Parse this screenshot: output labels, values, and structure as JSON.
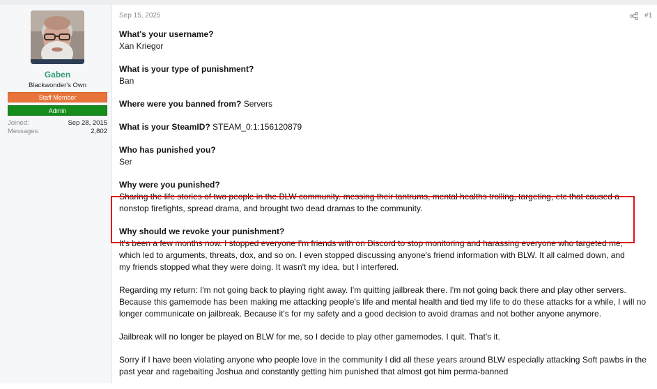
{
  "user": {
    "name": "Gaben",
    "title": "Blackwonder's Own",
    "banners": [
      "Staff Member",
      "Admin"
    ],
    "banner_colors": {
      "staff": "#e8743b",
      "admin": "#158c1c"
    },
    "name_color": "#2e9c6f",
    "joined_label": "Joined:",
    "joined_value": "Sep 28, 2015",
    "messages_label": "Messages:",
    "messages_value": "2,802"
  },
  "post": {
    "date": "Sep 15, 2025",
    "number": "#1",
    "share_icon": "share-icon",
    "highlight_color": "#dd0f17",
    "q_username": "What's your username?",
    "a_username": "Xan Kriegor",
    "q_type": "What is your type of punishment?",
    "a_type": "Ban",
    "q_where": "Where were you banned from?",
    "a_where": " Servers",
    "q_steamid": "What is your SteamID?",
    "a_steamid": " STEAM_0:1:156120879",
    "q_who": "Who has punished you?",
    "a_who": "Ser",
    "q_why": "Why were you punished?",
    "a_why": "Sharing the life stories of two people in the BLW community. messing their tantrums, mental healths trolling, targeting, etc that caused a nonstop firefights, spread drama, and brought two dead dramas to the community.",
    "q_revoke": "Why should we revoke your punishment?",
    "p1": "It's been a few months now. I stopped everyone I'm friends with on Discord to stop monitoring and harassing everyone who targeted me, which led to arguments, threats, dox, and so on. I even stopped discussing anyone's friend information with BLW. It all calmed down, and my friends stopped what they were doing. It wasn't my idea, but I interfered.",
    "p2": "Regarding my return: I'm not going back to playing right away. I'm quitting jailbreak there. I'm not going back there and play other servers. Because this gamemode has been making me attacking people's life and mental health and tied my life to do these attacks for a while, I will no longer communicate on jailbreak. Because it's for my safety and a good decision to avoid dramas and not bother anyone anymore.",
    "p3": "Jailbreak will no longer be played on BLW for me, so I decide to play other gamemodes. I quit. That's it.",
    "p4": "Sorry if I have been violating anyone who people love in the community I did all these years around BLW especially attacking Soft pawbs in the past year and ragebaiting Joshua and constantly getting him punished that almost got him perma-banned"
  }
}
